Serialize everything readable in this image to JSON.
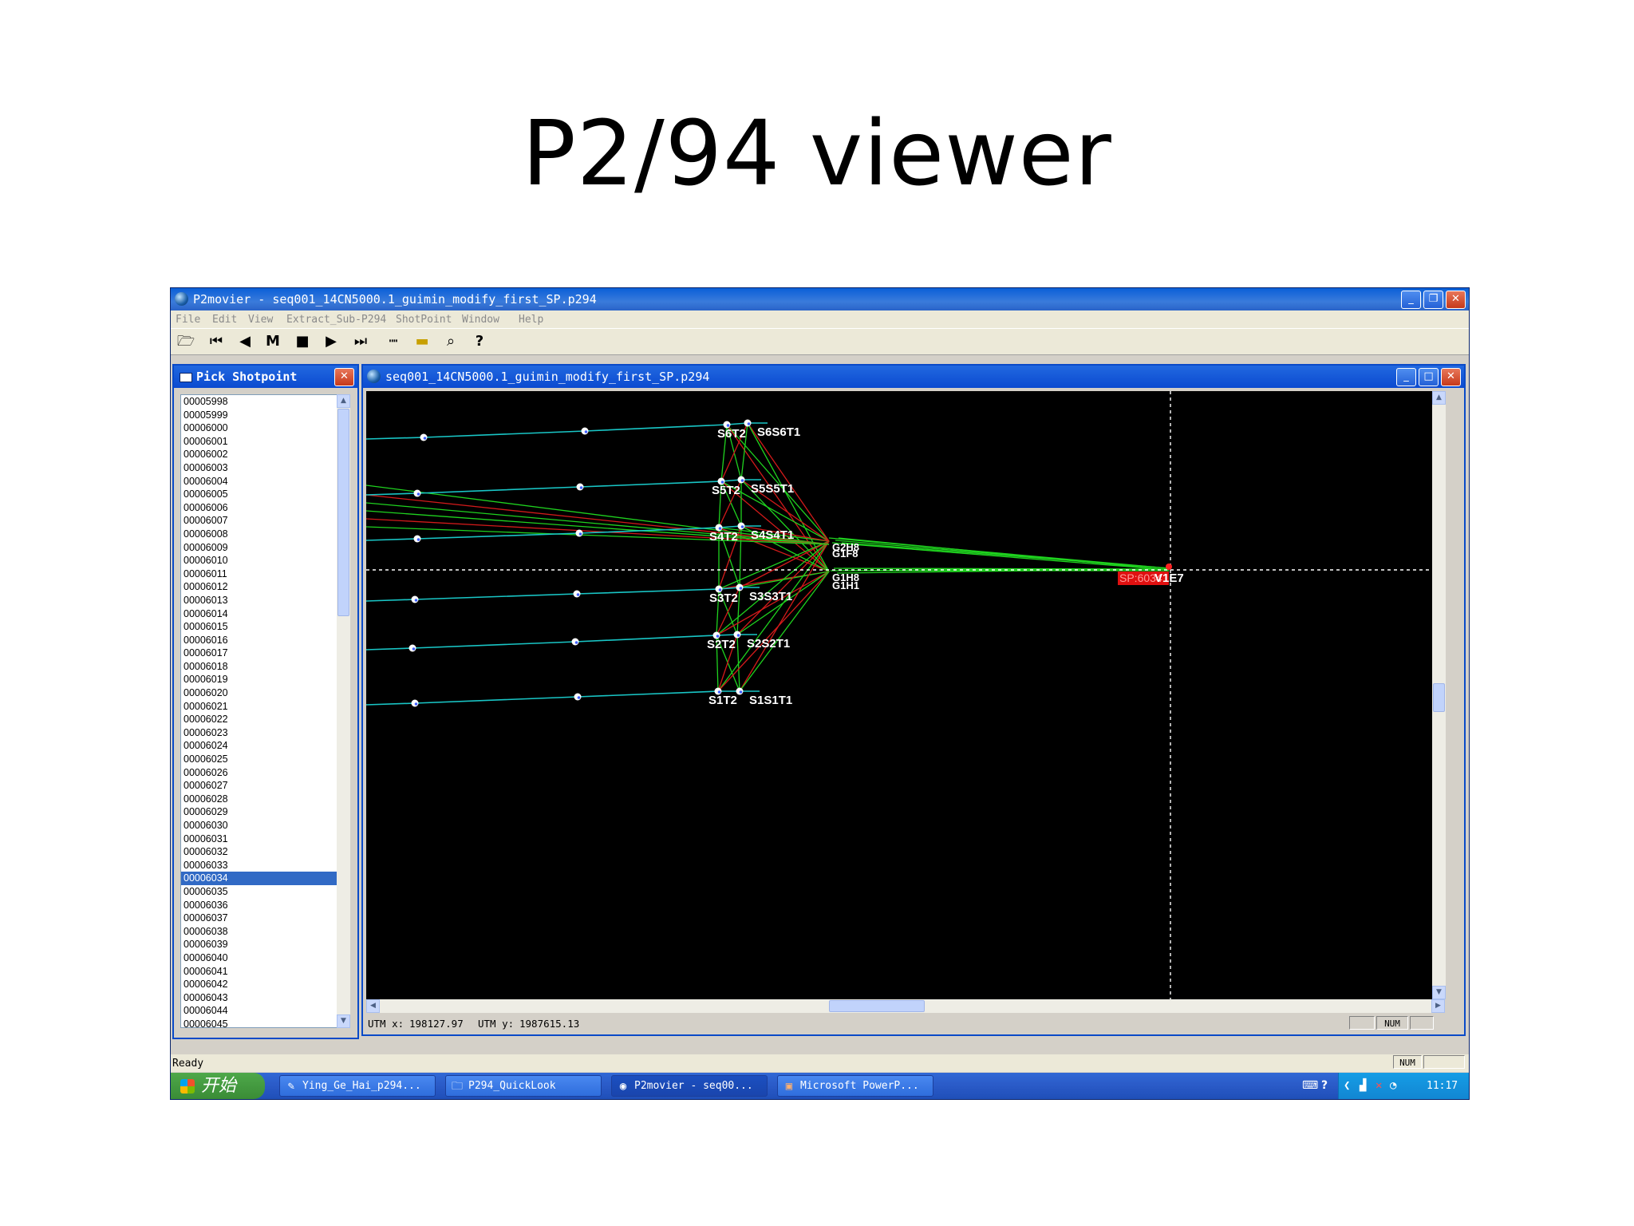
{
  "slide": {
    "title": "P2/94 viewer"
  },
  "app": {
    "title": "P2movier - seq001_14CN5000.1_guimin_modify_first_SP.p294",
    "menu": [
      "File",
      "Edit",
      "View",
      "Extract_Sub-P294",
      "ShotPoint",
      "Window",
      "Help"
    ],
    "toolbar_icons": [
      "open-folder-icon",
      "first-icon",
      "previous-icon",
      "mark-icon",
      "stop-icon",
      "play-icon",
      "last-icon",
      "ruler-icon",
      "ruler-highlight-icon",
      "zoom-icon",
      "help-icon"
    ],
    "toolbar_glyphs": [
      "🗁",
      "⏮",
      "◀",
      "M",
      "■",
      "▶",
      "⏭",
      "┉",
      "▬",
      "⌕",
      "?"
    ]
  },
  "pick_panel": {
    "title": "Pick Shotpoint",
    "close": "✕",
    "items": [
      "00005998",
      "00005999",
      "00006000",
      "00006001",
      "00006002",
      "00006003",
      "00006004",
      "00006005",
      "00006006",
      "00006007",
      "00006008",
      "00006009",
      "00006010",
      "00006011",
      "00006012",
      "00006013",
      "00006014",
      "00006015",
      "00006016",
      "00006017",
      "00006018",
      "00006019",
      "00006020",
      "00006021",
      "00006022",
      "00006023",
      "00006024",
      "00006025",
      "00006026",
      "00006027",
      "00006028",
      "00006029",
      "00006030",
      "00006031",
      "00006032",
      "00006033",
      "00006034",
      "00006035",
      "00006036",
      "00006037",
      "00006038",
      "00006039",
      "00006040",
      "00006041",
      "00006042",
      "00006043",
      "00006044",
      "00006045"
    ],
    "selected": "00006034"
  },
  "viewer": {
    "title": "seq001_14CN5000.1_guimin_modify_first_SP.p294",
    "labels": [
      {
        "left": "S6T2",
        "right": "S6S6T1"
      },
      {
        "left": "S5T2",
        "right": "S5S5T1"
      },
      {
        "left": "S4T2",
        "right": "S4S4T1"
      },
      {
        "left": "S3T2",
        "right": "S3S3T1"
      },
      {
        "left": "S2T2",
        "right": "S2S2T1"
      },
      {
        "left": "S1T2",
        "right": "S1S1T1"
      }
    ],
    "gun_labels": [
      "G2H8",
      "G1F8",
      "G1H8",
      "G1H1"
    ],
    "sp_label": "SP:6034",
    "vessel_label": "V1E7",
    "utm_x_label": "UTM x:",
    "utm_x": "198127.97",
    "utm_y_label": "UTM y:",
    "utm_y": "1987615.13",
    "num_indicator": "NUM"
  },
  "status": {
    "text": "Ready",
    "num": "NUM"
  },
  "taskbar": {
    "start": "开始",
    "tasks": [
      {
        "label": "Ying_Ge_Hai_p294...",
        "icon": "✎"
      },
      {
        "label": "P294_QuickLook",
        "icon": "🗀"
      },
      {
        "label": "P2movier - seq00...",
        "icon": "◉"
      },
      {
        "label": "Microsoft PowerP...",
        "icon": "▣"
      }
    ],
    "clock": "11:17"
  },
  "colors": {
    "streamer": "#19c6c6",
    "rope_green": "#1fd21f",
    "rope_red": "#d21a1a",
    "sp_box": "#e01010",
    "selection": "#316ac5",
    "xp_blue": "#0a5fd8"
  }
}
